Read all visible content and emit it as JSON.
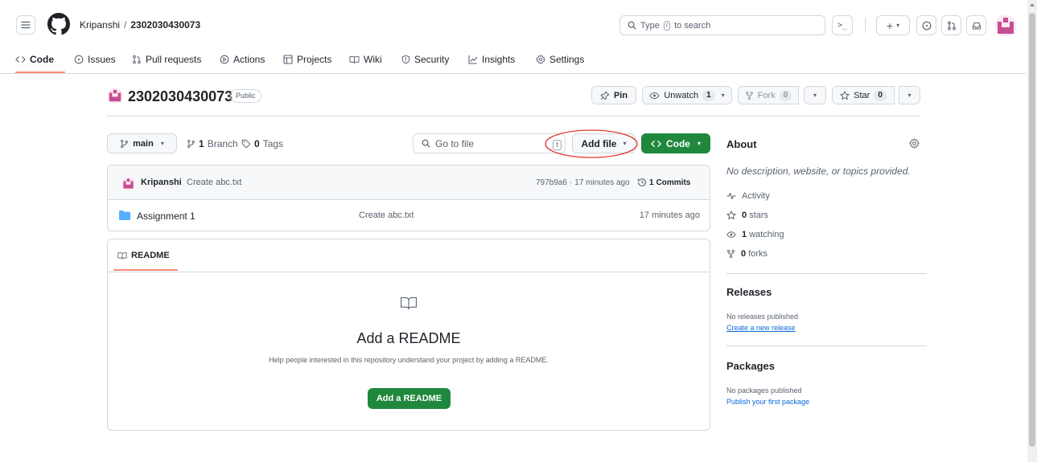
{
  "header": {
    "owner": "Kripanshi",
    "separator": "/",
    "repo": "2302030430073",
    "search_prefix": "Type",
    "search_key": "/",
    "search_suffix": "to search",
    "terminal_glyph": ">_",
    "plus_glyph": "+",
    "caret_glyph": "▾"
  },
  "nav": {
    "tabs": [
      {
        "label": "Code",
        "icon": "code-icon"
      },
      {
        "label": "Issues",
        "icon": "issue-icon"
      },
      {
        "label": "Pull requests",
        "icon": "pull-request-icon"
      },
      {
        "label": "Actions",
        "icon": "play-icon"
      },
      {
        "label": "Projects",
        "icon": "table-icon"
      },
      {
        "label": "Wiki",
        "icon": "book-icon"
      },
      {
        "label": "Security",
        "icon": "shield-icon"
      },
      {
        "label": "Insights",
        "icon": "graph-icon"
      },
      {
        "label": "Settings",
        "icon": "gear-icon"
      }
    ]
  },
  "repo": {
    "name": "2302030430073",
    "visibility": "Public",
    "pin_label": "Pin",
    "unwatch_label": "Unwatch",
    "unwatch_count": "1",
    "fork_label": "Fork",
    "fork_count": "0",
    "star_label": "Star",
    "star_count": "0"
  },
  "filebar": {
    "branch": "main",
    "branch_count": "1",
    "branch_word": "Branch",
    "tag_count": "0",
    "tag_word": "Tags",
    "goto_placeholder": "Go to file",
    "goto_key": "t",
    "add_file_label": "Add file",
    "code_label": "Code"
  },
  "commit": {
    "author": "Kripanshi",
    "message": "Create abc.txt",
    "hash": "797b9a6",
    "dot": "·",
    "time": "17 minutes ago",
    "commits_count": "1",
    "commits_word": "Commits"
  },
  "files": [
    {
      "name": "Assignment 1",
      "message": "Create abc.txt",
      "time": "17 minutes ago"
    }
  ],
  "readme": {
    "tab_label": "README",
    "heading": "Add a README",
    "help": "Help people interested in this repository understand your project by adding a README.",
    "button": "Add a README"
  },
  "about": {
    "title": "About",
    "description": "No description, website, or topics provided.",
    "activity": "Activity",
    "stars_count": "0",
    "stars_word": "stars",
    "watching_count": "1",
    "watching_word": "watching",
    "forks_count": "0",
    "forks_word": "forks"
  },
  "releases": {
    "title": "Releases",
    "none": "No releases published",
    "create_link": "Create a new release"
  },
  "packages": {
    "title": "Packages",
    "none": "No packages published",
    "publish_link": "Publish your first package"
  },
  "colors": {
    "accent_green": "#1f883d",
    "annotation_red": "#e5342f",
    "avatar_pink": "#c64d92",
    "link_blue": "#0969da",
    "tab_underline": "#fd8c73"
  }
}
